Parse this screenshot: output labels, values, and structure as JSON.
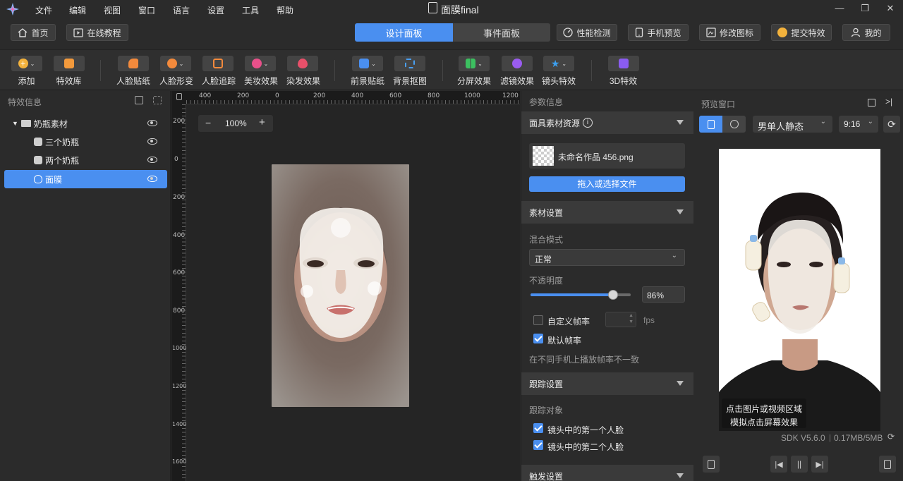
{
  "app": {
    "title": "面膜final"
  },
  "menu": [
    "文件",
    "编辑",
    "视图",
    "窗口",
    "语言",
    "设置",
    "工具",
    "帮助"
  ],
  "nav": {
    "home": "首页",
    "tutorial": "在线教程",
    "tabs": [
      "设计面板",
      "事件面板"
    ],
    "perf": "性能检测",
    "phone": "手机预览",
    "icon": "修改图标",
    "submit": "提交特效",
    "mine": "我的"
  },
  "toolbar": [
    {
      "label": "添加",
      "color": "#f3b23c"
    },
    {
      "label": "特效库",
      "color": "#f39a3c"
    },
    {
      "label": "人脸贴纸",
      "color": "#f38a3c"
    },
    {
      "label": "人脸形变",
      "color": "#f38a3c"
    },
    {
      "label": "人脸追踪",
      "color": "#f38a3c"
    },
    {
      "label": "美妆效果",
      "color": "#e8508a"
    },
    {
      "label": "染发效果",
      "color": "#e8506a"
    },
    {
      "label": "前景贴纸",
      "color": "#4a8ff0"
    },
    {
      "label": "背景抠图",
      "color": "#4a9ff0"
    },
    {
      "label": "分屏效果",
      "color": "#3cc060"
    },
    {
      "label": "滤镜效果",
      "color": "#9a5cf0"
    },
    {
      "label": "镜头特效",
      "color": "#3ca0f0"
    },
    {
      "label": "3D特效",
      "color": "#8a5cf0"
    }
  ],
  "left": {
    "title": "特效信息",
    "tree": [
      {
        "label": "奶瓶素材"
      },
      {
        "label": "三个奶瓶"
      },
      {
        "label": "两个奶瓶"
      },
      {
        "label": "面膜"
      }
    ]
  },
  "canvas": {
    "zoom": "100%",
    "ruler_top": [
      "400",
      "200",
      "0",
      "200",
      "400",
      "600",
      "800",
      "1000",
      "1200"
    ],
    "ruler_left": [
      "200",
      "0",
      "200",
      "400",
      "600",
      "800",
      "1000",
      "1200",
      "1400",
      "1600"
    ]
  },
  "params": {
    "title": "参数信息",
    "sec1": "面具素材资源",
    "file": "未命名作品 456.png",
    "upload": "拖入或选择文件",
    "sec2": "素材设置",
    "blend_label": "混合模式",
    "blend_value": "正常",
    "opacity_label": "不透明度",
    "opacity_value": "86%",
    "opacity": 0.86,
    "custom_fps": "自定义帧率",
    "fps_unit": "fps",
    "default_fps": "默认帧率",
    "fps_note": "在不同手机上播放帧率不一致",
    "sec3": "跟踪设置",
    "track_label": "跟踪对象",
    "track1": "镜头中的第一个人脸",
    "track2": "镜头中的第二个人脸",
    "sec4": "触发设置"
  },
  "preview": {
    "title": "预览窗口",
    "model": "男单人静态",
    "ratio": "9:16",
    "hint1": "点击图片或视频区域",
    "hint2": "模拟点击屏幕效果",
    "sdk": "SDK V5.6.0",
    "size": "0.17MB/5MB"
  }
}
